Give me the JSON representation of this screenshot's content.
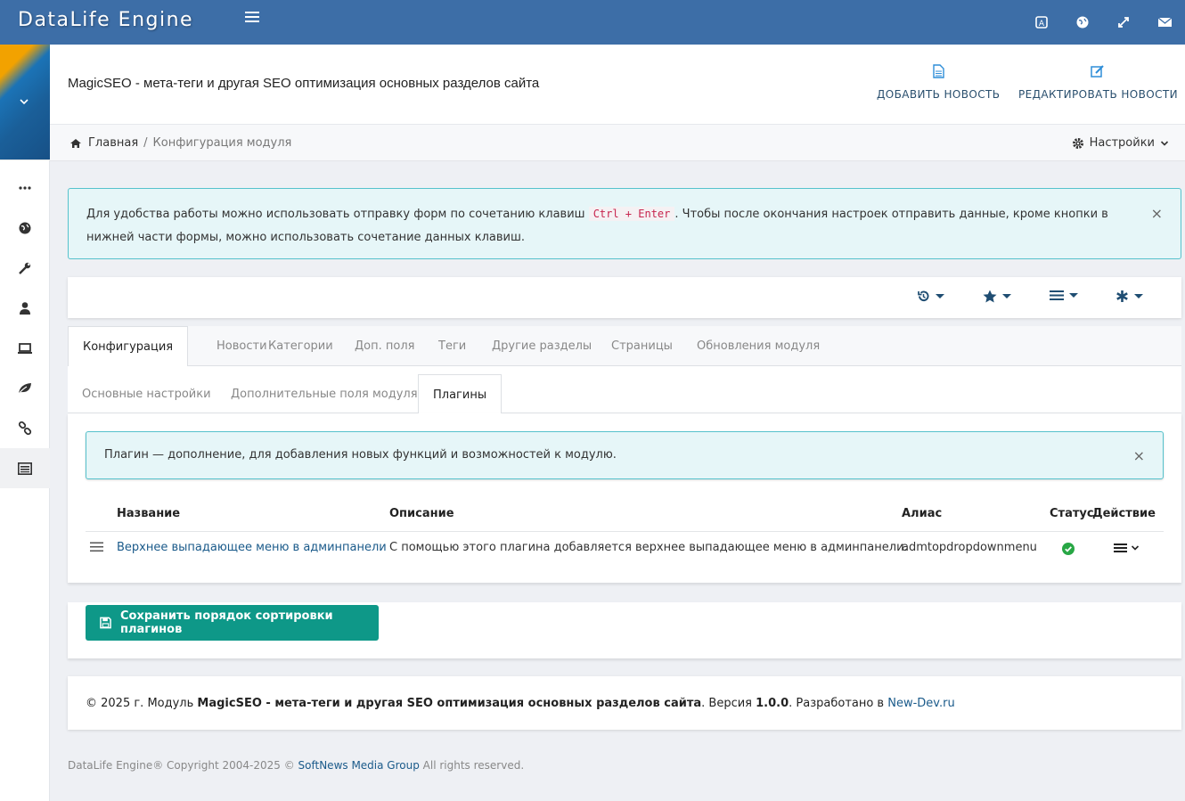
{
  "app": {
    "logo": "DataLife Engine"
  },
  "header": {
    "title": "MagicSEO - мета-теги и другая SEO оптимизация основных разделов сайта",
    "add_news": "ДОБАВИТЬ НОВОСТЬ",
    "edit_news": "РЕДАКТИРОВАТЬ НОВОСТИ"
  },
  "breadcrumb": {
    "home": "Главная",
    "separator": "/",
    "current": "Конфигурация модуля"
  },
  "settings": {
    "label": "Настройки"
  },
  "notice": {
    "text_before": "Для удобства работы можно использовать отправку форм по сочетанию клавиш ",
    "shortcut": "Ctrl + Enter",
    "text_after": ". Чтобы после окончания настроек отправить данные, кроме кнопки в нижней части формы, можно использовать сочетание данных клавиш.",
    "close": "×"
  },
  "tabs": [
    {
      "label": "Конфигурация"
    },
    {
      "label": "Новости"
    },
    {
      "label": "Категории"
    },
    {
      "label": "Доп. поля"
    },
    {
      "label": "Теги"
    },
    {
      "label": "Другие разделы"
    },
    {
      "label": "Страницы"
    },
    {
      "label": "Обновления модуля"
    }
  ],
  "subtabs": [
    {
      "label": "Основные настройки"
    },
    {
      "label": "Дополнительные поля модуля"
    },
    {
      "label": "Плагины"
    }
  ],
  "plugin_notice": {
    "text": "Плагин — дополнение, для добавления новых функций и возможностей к модулю.",
    "close": "×"
  },
  "table": {
    "columns": {
      "name": "Название",
      "description": "Описание",
      "alias": "Алиас",
      "status": "Статус",
      "action": "Действие"
    },
    "rows": [
      {
        "name": "Верхнее выпадающее меню в админпанели",
        "description": "С помощью этого плагина добавляется верхнее выпадающее меню в админпанели.",
        "alias": "admtopdropdownmenu"
      }
    ]
  },
  "save_button": {
    "label": "Сохранить порядок сортировки плагинов"
  },
  "footer": {
    "prefix": "© 2025 г. Модуль ",
    "module": "MagicSEO - мета-теги и другая SEO оптимизация основных разделов сайта",
    "version_prefix": ". Версия ",
    "version": "1.0.0",
    "dev_prefix": ". Разработано в ",
    "dev_link": "New-Dev.ru"
  },
  "copyright": {
    "prefix": "DataLife Engine® Copyright 2004-2025 © ",
    "link": "SoftNews Media Group",
    "suffix": " All rights reserved."
  },
  "colors": {
    "topbar": "#3d6ea7",
    "accent": "#0e9888",
    "info_bg": "#e6f6f8",
    "info_border": "#56c2cc",
    "status_ok": "#28a745"
  }
}
